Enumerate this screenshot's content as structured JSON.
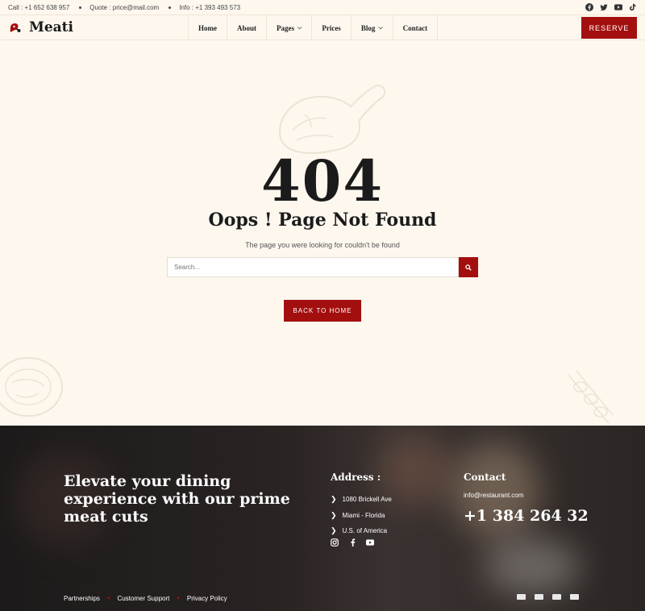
{
  "topbar": {
    "call": "Call : +1 652 638 957",
    "quote": "Quote : price@mail.com",
    "info": "Info : +1 393 493 573",
    "social_icons": [
      "facebook-icon",
      "twitter-icon",
      "youtube-icon",
      "tiktok-icon"
    ]
  },
  "header": {
    "logo": "Meati",
    "nav": [
      {
        "label": "Home",
        "dropdown": false
      },
      {
        "label": "About",
        "dropdown": false
      },
      {
        "label": "Pages",
        "dropdown": true
      },
      {
        "label": "Prices",
        "dropdown": false
      },
      {
        "label": "Blog",
        "dropdown": true
      },
      {
        "label": "Contact",
        "dropdown": false
      }
    ],
    "reserve": "RESERVE"
  },
  "main": {
    "code": "404",
    "title": "Oops ! Page Not Found",
    "subtitle": "The page you were looking for couldn't be found",
    "search_placeholder": "Search...",
    "back_button": "BACK TO HOME"
  },
  "footer": {
    "heading": "Elevate your dining experience with our prime meat cuts",
    "address_title": "Address :",
    "address_lines": [
      "1080 Brickell Ave",
      "Miami - Florida",
      "U.S. of America"
    ],
    "social_icons": [
      "instagram-icon",
      "facebook-icon",
      "youtube-icon"
    ],
    "contact_title": "Contact",
    "email": "info@restaurant.com",
    "phone": "+1 384 264 32",
    "links": [
      "Partnerships",
      "Customer Support",
      "Privacy Policy"
    ],
    "payment_icons": [
      "visa-icon",
      "mastercard-icon",
      "paypal-icon",
      "amex-icon"
    ]
  },
  "colors": {
    "accent": "#a30f0f",
    "background": "#fdf7ee",
    "footer": "#221e1d"
  }
}
